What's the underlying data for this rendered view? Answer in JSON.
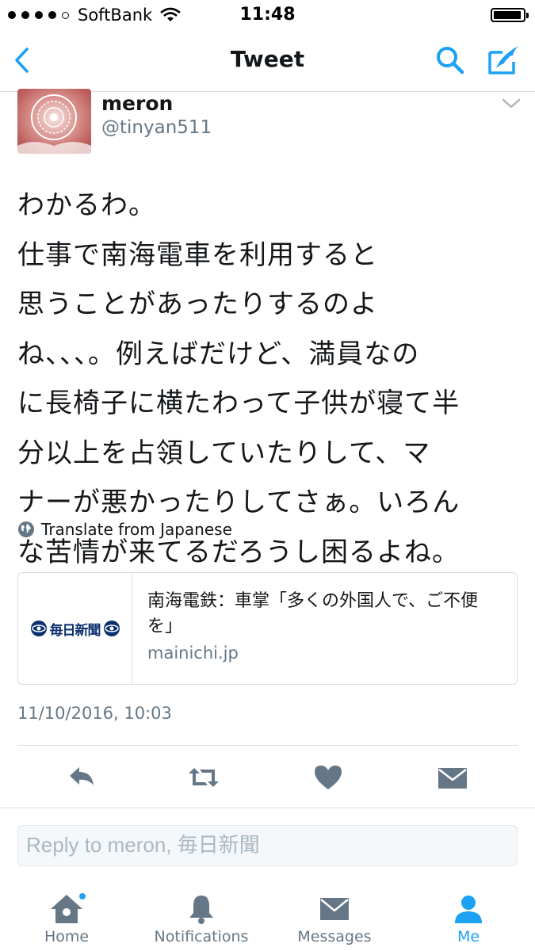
{
  "status_bar": {
    "carrier": "SoftBank",
    "time": "11:48"
  },
  "nav": {
    "title": "Tweet"
  },
  "tweet": {
    "name": "meron",
    "handle": "@tinyan511",
    "text": "わかるわ。\n仕事で南海電車を利用すると\n思うことがあったりするのよ\nね、、、。例えばだけど、満員なの\nに長椅子に横たわって子供が寝て半\n分以上を占領していたりして、マ\nナーが悪かったりしてさぁ。いろん\nな苦情が来てるだろうし困るよね。",
    "translate_label": "Translate from Japanese",
    "timestamp": "11/10/2016, 10:03"
  },
  "card": {
    "logo_text": "毎日新聞",
    "title": "南海電鉄：車掌「多くの外国人で、ご不便を」",
    "domain": "mainichi.jp"
  },
  "reply": {
    "placeholder": "Reply to meron, 毎日新聞"
  },
  "tabs": [
    {
      "label": "Home",
      "icon": "home-icon",
      "active": false,
      "badge": true
    },
    {
      "label": "Notifications",
      "icon": "bell-icon",
      "active": false
    },
    {
      "label": "Messages",
      "icon": "envelope-icon",
      "active": false
    },
    {
      "label": "Me",
      "icon": "person-icon",
      "active": true
    }
  ],
  "colors": {
    "accent": "#1da1f2",
    "icon_gray": "#657786",
    "text": "#14171a",
    "secondary_text": "#657786"
  }
}
